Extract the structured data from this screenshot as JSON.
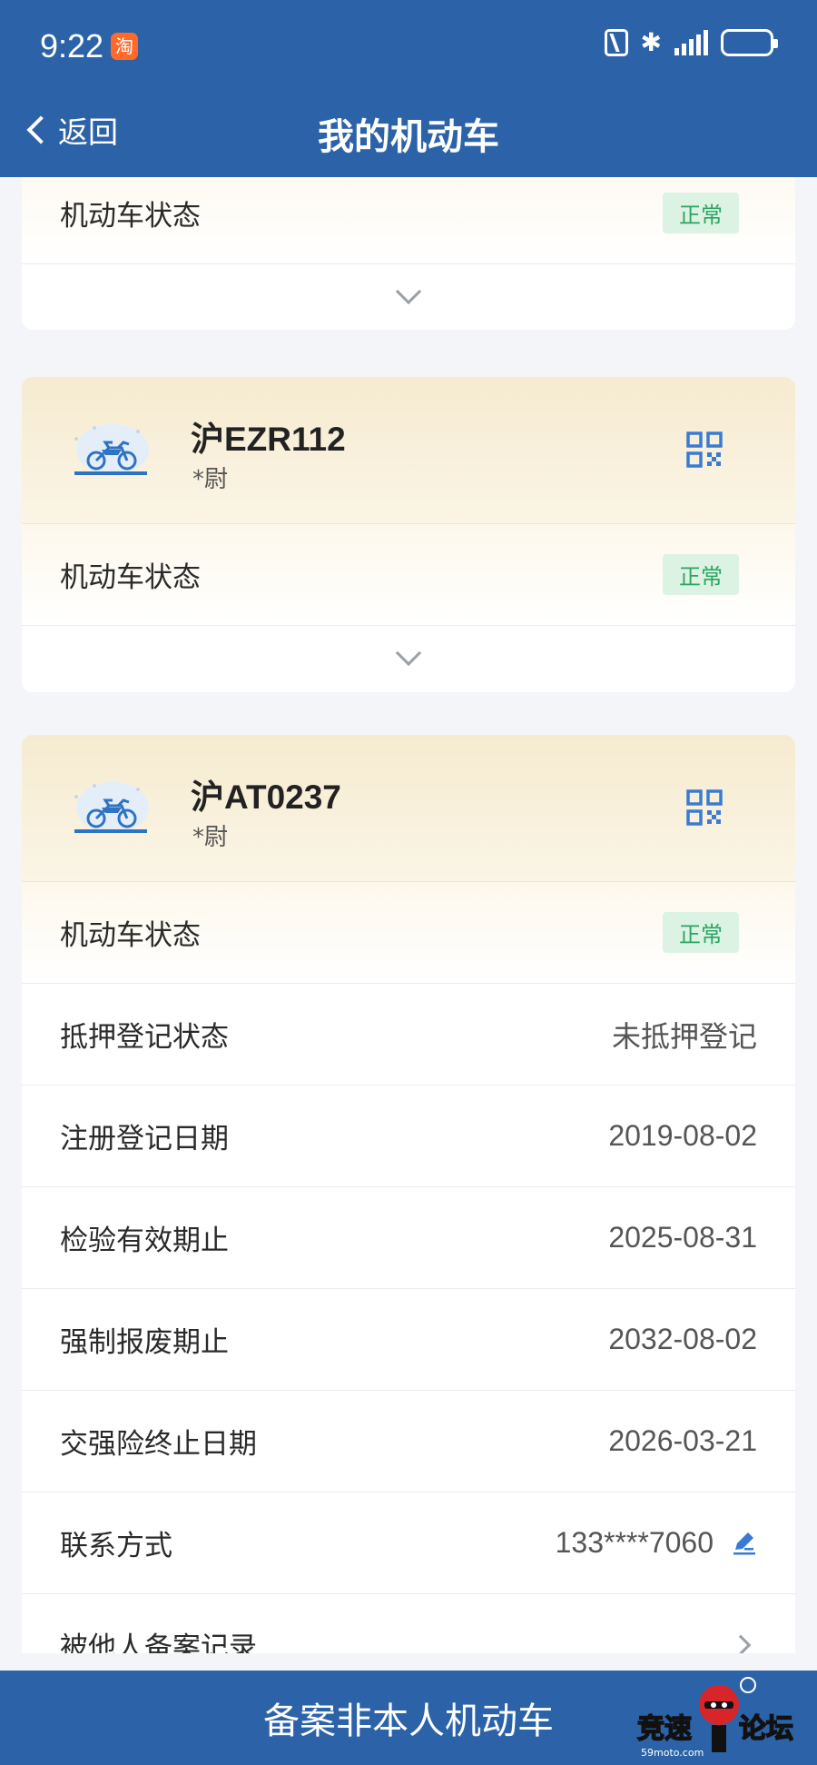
{
  "status_bar": {
    "time": "9:22",
    "app_badge": "淘"
  },
  "header": {
    "back_label": "返回",
    "title": "我的机动车"
  },
  "cards": [
    {
      "rows": [
        {
          "label": "机动车状态",
          "badge": "正常"
        }
      ]
    },
    {
      "plate": "沪EZR112",
      "owner": "*尉",
      "rows": [
        {
          "label": "机动车状态",
          "badge": "正常"
        }
      ]
    },
    {
      "plate": "沪AT0237",
      "owner": "*尉",
      "rows": [
        {
          "label": "机动车状态",
          "badge": "正常"
        },
        {
          "label": "抵押登记状态",
          "value": "未抵押登记"
        },
        {
          "label": "注册登记日期",
          "value": "2019-08-02"
        },
        {
          "label": "检验有效期止",
          "value": "2025-08-31"
        },
        {
          "label": "强制报废期止",
          "value": "2032-08-02"
        },
        {
          "label": "交强险终止日期",
          "value": "2026-03-21"
        },
        {
          "label": "联系方式",
          "value": "133****7060"
        },
        {
          "label": "被他人备案记录"
        }
      ]
    }
  ],
  "bottom": {
    "label": "备案非本人机动车"
  },
  "watermark": {
    "text": "竞速论坛",
    "site": "59moto.com"
  },
  "colors": {
    "primary": "#2c63a8",
    "badge_bg": "#dcf3e4",
    "badge_text": "#2aa561",
    "head_gradient": "#f6ebd0"
  }
}
